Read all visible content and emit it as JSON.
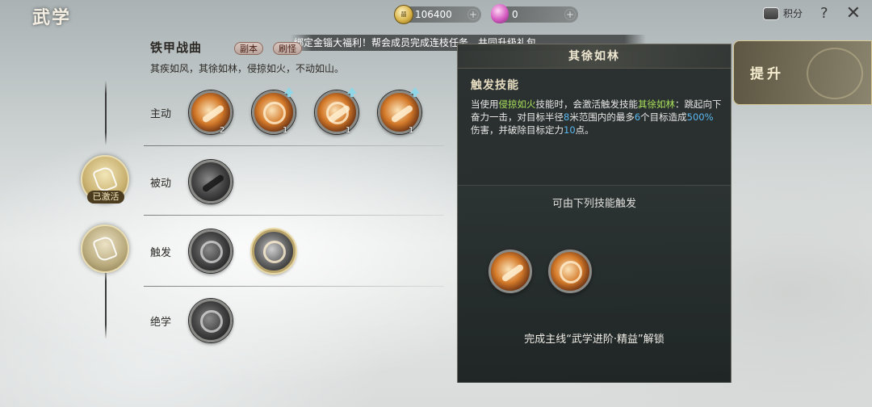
{
  "header": {
    "title": "武学",
    "coins": "106400",
    "gems": "0",
    "points_label": "积分",
    "help": "?",
    "close": "✕",
    "coin_glyph": "囍"
  },
  "marquee": "绑定金锱大福利！帮会成员完成连枝任务，共同升级礼包",
  "set": {
    "title": "铁甲战曲",
    "tags": [
      "副本",
      "刷怪"
    ],
    "desc": "其疾如风，其徐如林，侵掠如火，不动如山。"
  },
  "rows": {
    "active": "主动",
    "passive": "被动",
    "trigger": "触发",
    "ultimate": "绝学"
  },
  "skill_levels": [
    "2",
    "1",
    "1",
    "1"
  ],
  "side": {
    "activated": "已激活"
  },
  "panel": {
    "title": "其徐如林",
    "subtitle": "触发技能",
    "desc": {
      "p1": "当使用",
      "s1": "侵掠如火",
      "p2": "技能时，会激活触发技能",
      "s2": "其徐如林",
      "p3": "：跳起向下奋力一击，对目标半径",
      "n1": "8",
      "p4": "米范围内的最多",
      "n2": "6",
      "p5": "个目标造成",
      "n3": "500%",
      "p6": "伤害，并破除目标定力",
      "n4": "10",
      "p7": "点。"
    },
    "trigger_label": "可由下列技能触发",
    "unlock_text": "完成主线“武学进阶·精益”解锁"
  },
  "promote": "提升",
  "colors": {
    "accent_gold": "#c9b170",
    "highlight_green": "#a8e05a",
    "highlight_blue": "#5ab8f0",
    "panel_bg": "#262c2c"
  }
}
